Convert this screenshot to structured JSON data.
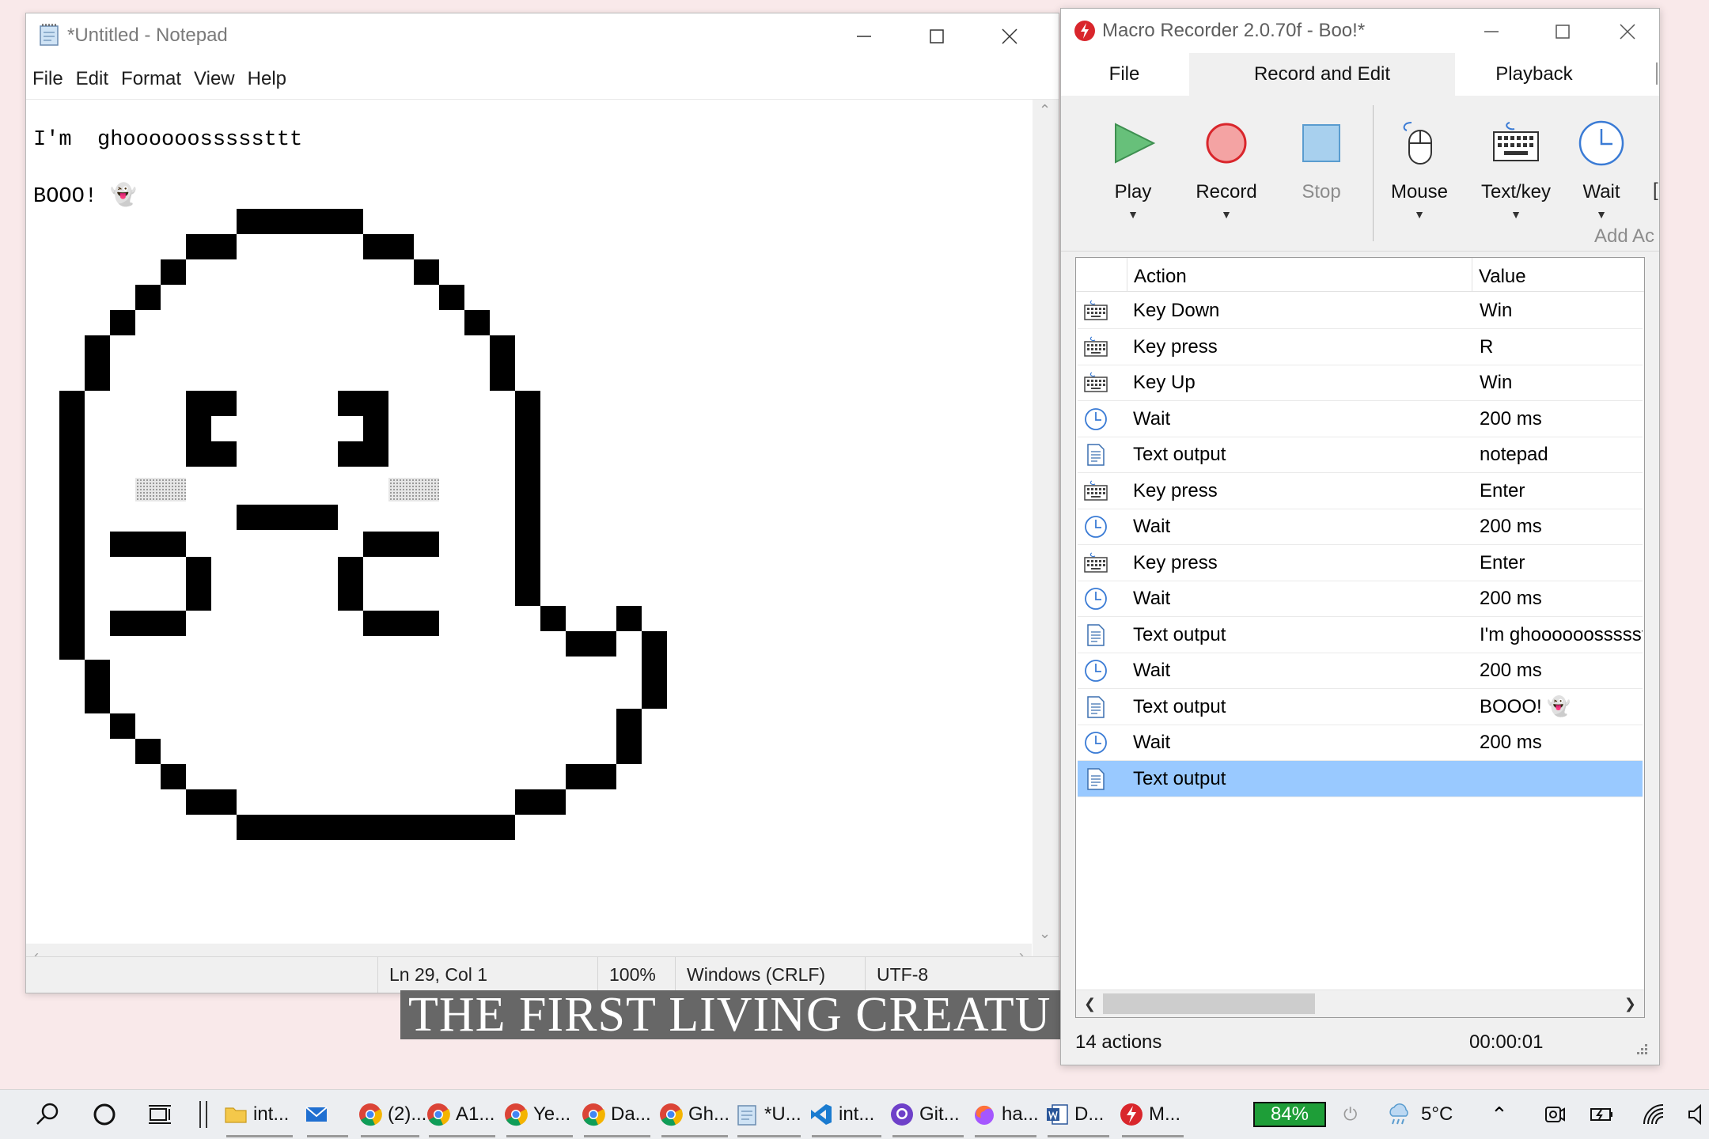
{
  "notepad": {
    "title": "*Untitled - Notepad",
    "menu": [
      "File",
      "Edit",
      "Format",
      "View",
      "Help"
    ],
    "lines": [
      "I'm  ghoooooosssssttt",
      "BOOO! 👻"
    ],
    "status": {
      "position": "Ln 29, Col 1",
      "zoom": "100%",
      "line_ending": "Windows (CRLF)",
      "encoding": "UTF-8"
    }
  },
  "macro": {
    "title": "Macro Recorder 2.0.70f - Boo!*",
    "tabs": [
      "File",
      "Record and Edit",
      "Playback"
    ],
    "active_tab": "Record and Edit",
    "ribbon": {
      "play": "Play",
      "record": "Record",
      "stop": "Stop",
      "mouse": "Mouse",
      "textkey": "Text/key",
      "wait": "Wait",
      "group_label": "Add Ac"
    },
    "columns": {
      "action": "Action",
      "value": "Value"
    },
    "rows": [
      {
        "icon": "keyboard-icon",
        "action": "Key Down",
        "value": "Win"
      },
      {
        "icon": "keyboard-icon",
        "action": "Key press",
        "value": "R"
      },
      {
        "icon": "keyboard-icon",
        "action": "Key Up",
        "value": "Win"
      },
      {
        "icon": "clock-icon",
        "action": "Wait",
        "value": "200 ms"
      },
      {
        "icon": "document-icon",
        "action": "Text output",
        "value": "notepad"
      },
      {
        "icon": "keyboard-icon",
        "action": "Key press",
        "value": "Enter"
      },
      {
        "icon": "clock-icon",
        "action": "Wait",
        "value": "200 ms"
      },
      {
        "icon": "keyboard-icon",
        "action": "Key press",
        "value": "Enter"
      },
      {
        "icon": "clock-icon",
        "action": "Wait",
        "value": "200 ms"
      },
      {
        "icon": "document-icon",
        "action": "Text output",
        "value": "I'm  ghoooooosssssttt"
      },
      {
        "icon": "clock-icon",
        "action": "Wait",
        "value": "200 ms"
      },
      {
        "icon": "document-icon",
        "action": "Text output",
        "value": "BOOO! 👻"
      },
      {
        "icon": "clock-icon",
        "action": "Wait",
        "value": "200 ms"
      },
      {
        "icon": "document-icon",
        "action": "Text output",
        "value": ""
      }
    ],
    "selected_row": 13,
    "status": {
      "count": "14 actions",
      "time": "00:00:01"
    }
  },
  "caption": "THE FIRST LIVING CREATU",
  "taskbar": {
    "items": [
      {
        "icon": "folder-icon",
        "label": "int..."
      },
      {
        "icon": "mail-icon",
        "label": ""
      },
      {
        "icon": "chrome-icon",
        "label": "(2)..."
      },
      {
        "icon": "chrome-icon",
        "label": "A1..."
      },
      {
        "icon": "chrome-icon",
        "label": "Ye..."
      },
      {
        "icon": "chrome-icon",
        "label": "Da..."
      },
      {
        "icon": "chrome-icon",
        "label": "Gh..."
      },
      {
        "icon": "notepad-icon",
        "label": "*U..."
      },
      {
        "icon": "vscode-icon",
        "label": "int..."
      },
      {
        "icon": "github-icon",
        "label": "Git..."
      },
      {
        "icon": "firefox-icon",
        "label": "ha..."
      },
      {
        "icon": "word-icon",
        "label": "D..."
      },
      {
        "icon": "macro-recorder-icon",
        "label": "M..."
      }
    ],
    "battery": "84%",
    "temperature": "5°C"
  },
  "colors": {
    "selection": "#99c9ff",
    "play": "#5cb85c",
    "record": "#f29e9e",
    "stop": "#a6cdeb",
    "battery": "#1e9e38",
    "macro_logo": "#d9262c"
  }
}
